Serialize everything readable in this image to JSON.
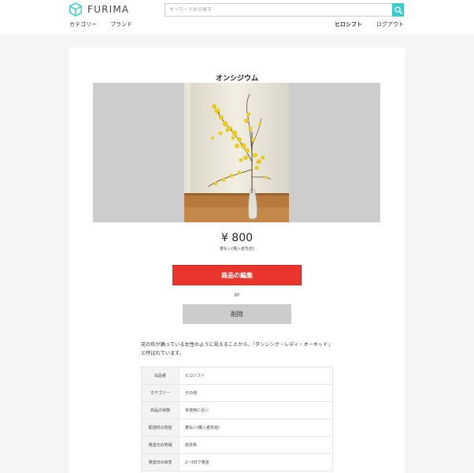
{
  "header": {
    "logo_text": "FURIMA",
    "search": {
      "placeholder": "キーワードから探す",
      "value": ""
    },
    "nav_left": [
      "カテゴリー",
      "ブランド"
    ],
    "user_name": "ヒロシフト",
    "logout_label": "ログアウト",
    "accent_color": "#3ccace"
  },
  "item": {
    "name": "オンシジウム",
    "price": "¥ 800",
    "shipping_note": "着払い(購入者負担)",
    "edit_label": "商品の編集",
    "or_text": "or",
    "delete_label": "削除",
    "description": "花の形が踊っている女性のように見えることから、「ダンシング・レディ・オーキッド」と呼ばれています。",
    "details": [
      {
        "label": "出品者",
        "value": "ヒロシフト"
      },
      {
        "label": "カテゴリー",
        "value": "その他"
      },
      {
        "label": "商品の状態",
        "value": "未使用に近い"
      },
      {
        "label": "配送料の負担",
        "value": "着払い(購入者負担)"
      },
      {
        "label": "発送元の地域",
        "value": "岐阜県"
      },
      {
        "label": "発送日の目安",
        "value": "2~3日で発送"
      }
    ],
    "edit_color": "#ea352d",
    "delete_color": "#cccccc"
  }
}
